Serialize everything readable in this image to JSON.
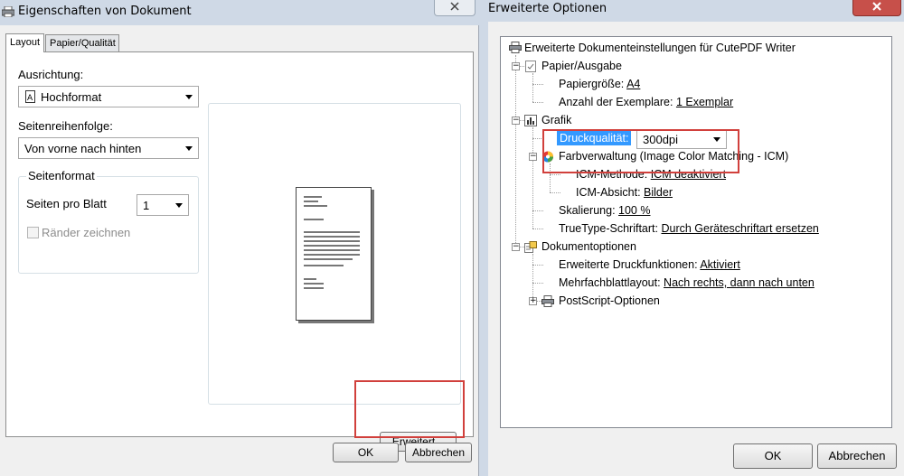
{
  "left_window": {
    "title": "Eigenschaften von Dokument",
    "tabs": [
      {
        "label": "Layout"
      },
      {
        "label": "Papier/Qualität"
      }
    ],
    "orientation_label": "Ausrichtung:",
    "orientation_value": "Hochformat",
    "page_order_label": "Seitenreihenfolge:",
    "page_order_value": "Von vorne nach hinten",
    "page_format_group": "Seitenformat",
    "pages_per_sheet_label": "Seiten pro Blatt",
    "pages_per_sheet_value": "1",
    "draw_borders_label": "Ränder zeichnen",
    "advanced_button": "Erweitert...",
    "ok_button": "OK",
    "cancel_button": "Abbrechen"
  },
  "right_window": {
    "title": "Erweiterte Optionen",
    "tree": {
      "root": "Erweiterte Dokumenteinstellungen für CutePDF Writer",
      "paper_output": "Papier/Ausgabe",
      "paper_size_label": "Papiergröße:",
      "paper_size_value": "A4",
      "copies_label": "Anzahl der Exemplare:",
      "copies_value": "1 Exemplar",
      "graphic": "Grafik",
      "print_quality_label": "Druckqualität:",
      "print_quality_value": "300dpi",
      "color_management": "Farbverwaltung (Image Color Matching - ICM)",
      "icm_method_label": "ICM-Methode:",
      "icm_method_value": "ICM deaktiviert",
      "icm_intent_label": "ICM-Absicht:",
      "icm_intent_value": "Bilder",
      "scaling_label": "Skalierung:",
      "scaling_value": "100 %",
      "truetype_label": "TrueType-Schriftart:",
      "truetype_value": "Durch Geräteschriftart ersetzen",
      "document_options": "Dokumentoptionen",
      "advanced_print_label": "Erweiterte Druckfunktionen:",
      "advanced_print_value": "Aktiviert",
      "multipage_label": "Mehrfachblattlayout:",
      "multipage_value": "Nach rechts, dann nach unten",
      "postscript": "PostScript-Optionen"
    },
    "ok_button": "OK",
    "cancel_button": "Abbrechen"
  },
  "colors": {
    "highlight": "#d1403c",
    "selection": "#3399ff"
  }
}
